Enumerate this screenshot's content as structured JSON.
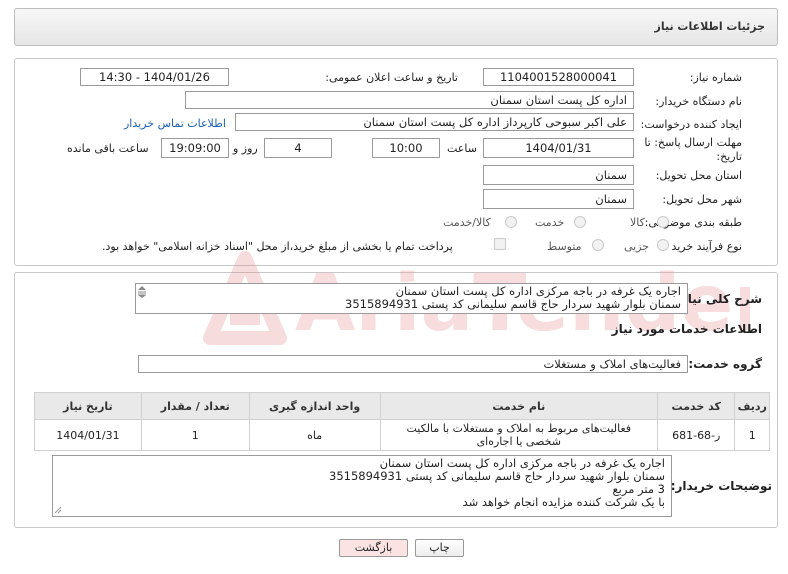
{
  "page": {
    "title": "جزئیات اطلاعات نیاز"
  },
  "form": {
    "need_number_label": "شماره نیاز:",
    "need_number": "1104001528000041",
    "announce_label": "تاریخ و ساعت اعلان عمومی:",
    "announce_value": "1404/01/26 - 14:30",
    "buyer_org_label": "نام دستگاه خریدار:",
    "buyer_org": "اداره کل پست استان سمنان",
    "creator_label": "ایجاد کننده درخواست:",
    "creator": "علی اکبر سبوحی کارپرداز اداره کل پست استان سمنان",
    "contact_link": "اطلاعات تماس خریدار",
    "deadline_label_1": "مهلت ارسال پاسخ: تا",
    "deadline_label_2": "تاریخ:",
    "deadline_date": "1404/01/31",
    "time_label": "ساعت",
    "deadline_time": "10:00",
    "days_value": "4",
    "days_label": "روز و",
    "remaining_time": "19:09:00",
    "remaining_label": "ساعت باقی مانده",
    "province_label": "استان محل تحویل:",
    "province": "سمنان",
    "city_label": "شهر محل تحویل:",
    "city": "سمنان",
    "category_label": "طبقه بندی موضوعی:",
    "category_options": [
      "کالا",
      "خدمت",
      "کالا/خدمت"
    ],
    "purchase_label": "نوع فرآیند خرید :",
    "purchase_options": [
      "جزیی",
      "متوسط"
    ],
    "purchase_note": "پرداخت تمام یا بخشی از مبلغ خرید،از محل \"اسناد خزانه اسلامی\" خواهد بود."
  },
  "summary": {
    "label": "شرح کلی نیاز:",
    "lines": [
      "اجاره یک غرفه در باجه مرکزی اداره کل پست استان سمنان",
      "سمنان بلوار شهید سردار حاج قاسم سلیمانی کد پستی 3515894931"
    ]
  },
  "services": {
    "heading": "اطلاعات خدمات مورد نیاز",
    "group_label": "گروه خدمت:",
    "group_value": "فعالیت‌های  املاک و مستغلات"
  },
  "table": {
    "headers": [
      "ردیف",
      "کد خدمت",
      "نام خدمت",
      "واحد اندازه گیری",
      "تعداد / مقدار",
      "تاریخ نیاز"
    ],
    "rows": [
      [
        "1",
        "ر-68-681",
        "فعالیت‌های مربوط به املاک و مستغلات با مالکیت شخصی یا اجاره‌ای",
        "ماه",
        "1",
        "1404/01/31"
      ]
    ]
  },
  "buyer_notes": {
    "label": "توضیحات خریدار:",
    "lines": [
      "اجاره یک غرفه در باجه مرکزی اداره کل پست استان سمنان",
      "سمنان بلوار شهید سردار حاج قاسم سلیمانی کد پستی 3515894931",
      "3 متر مربع",
      "با یک شرکت کننده مزایده انجام خواهد شد"
    ]
  },
  "buttons": {
    "print": "چاپ",
    "back": "بازگشت"
  },
  "watermark_text": "AriaTender.neT",
  "colors": {
    "link": "#1a5fb4",
    "back_button_bg": "#fbe3e3",
    "watermark": "#e9a0a0"
  }
}
